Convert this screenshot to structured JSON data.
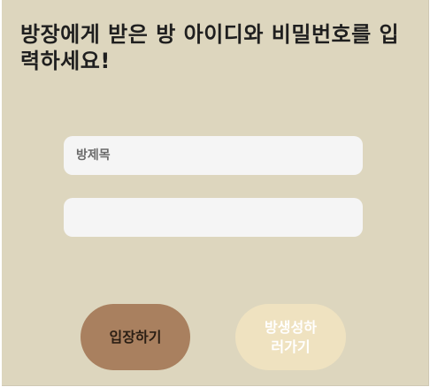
{
  "heading": "방장에게 받은 방 아이디와 비밀번호를 입력하세요!",
  "form": {
    "room_id_placeholder": "방제목",
    "room_id_value": "",
    "password_placeholder": "",
    "password_value": ""
  },
  "buttons": {
    "enter_label": "입장하기",
    "create_label": "방생성하\n러가기"
  },
  "colors": {
    "background": "#ddd6be",
    "input_background": "#f5f5f5",
    "enter_button": "#a9805f",
    "create_button": "#efe2c0"
  }
}
